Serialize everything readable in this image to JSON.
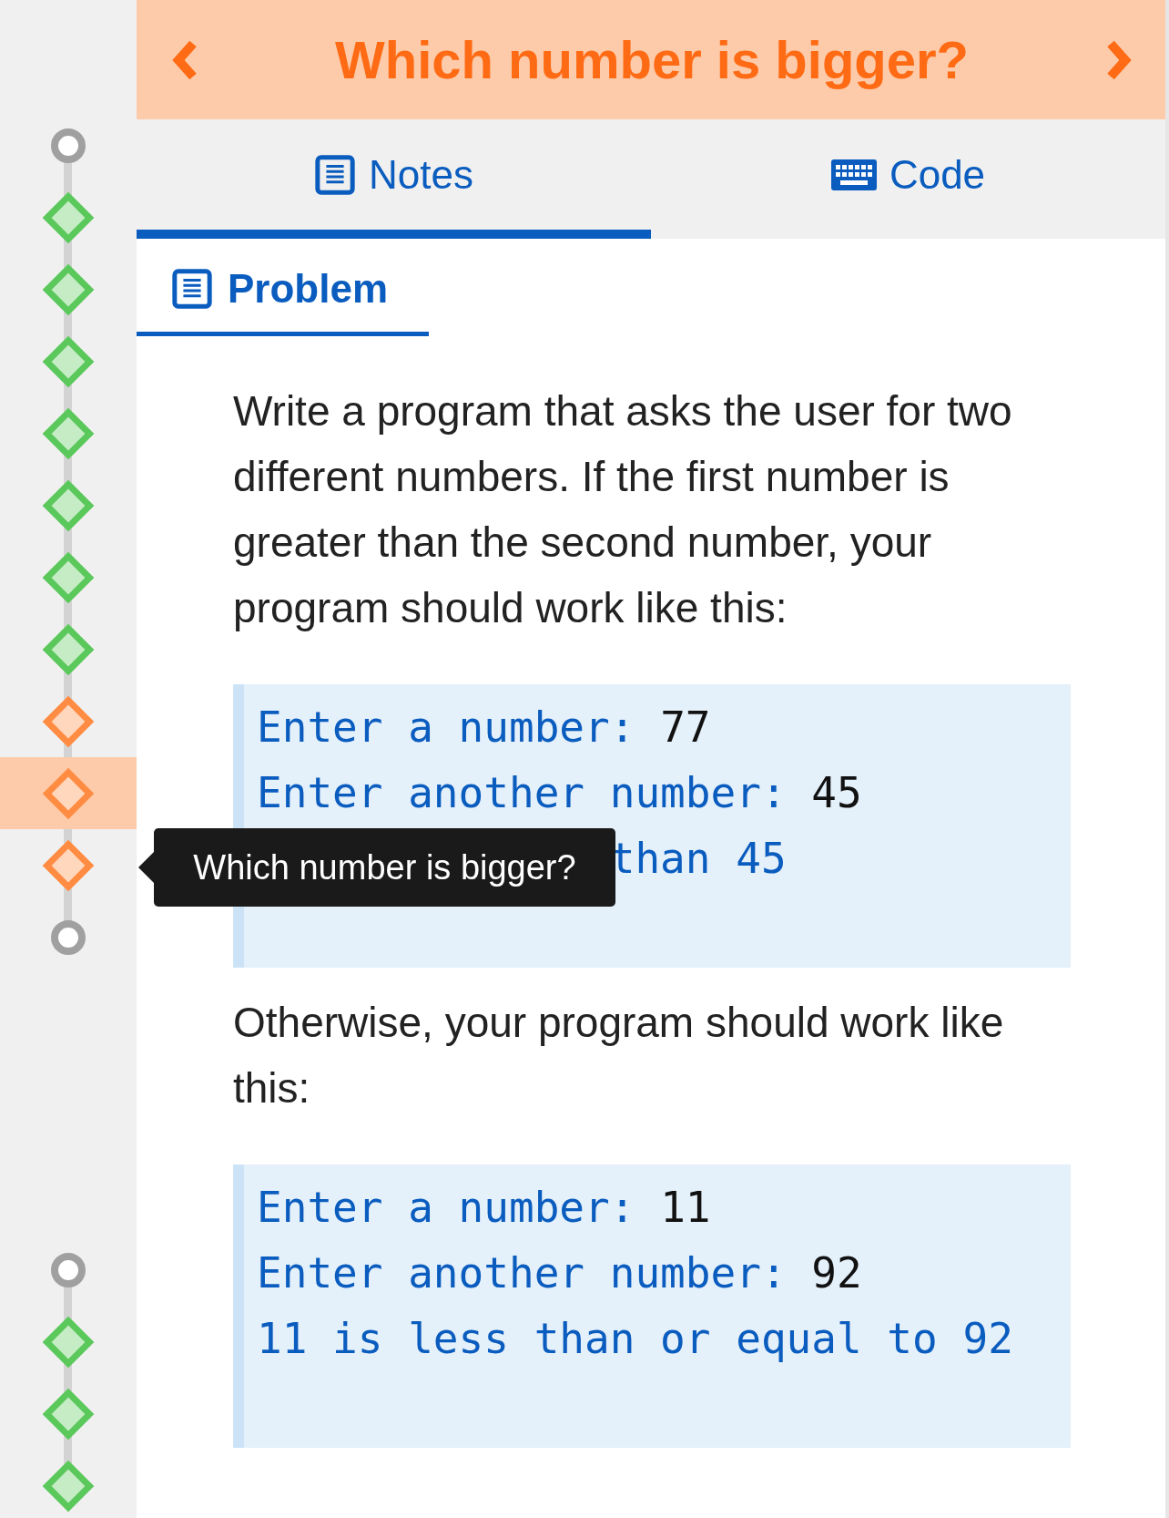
{
  "header": {
    "title": "Which number is bigger?"
  },
  "timeline": [
    {
      "items": [
        {
          "kind": "circle",
          "selected": false
        },
        {
          "kind": "diamond",
          "color": "#5ac85a",
          "selected": false
        },
        {
          "kind": "diamond",
          "color": "#5ac85a",
          "selected": false
        },
        {
          "kind": "diamond",
          "color": "#5ac85a",
          "selected": false
        },
        {
          "kind": "diamond",
          "color": "#5ac85a",
          "selected": false
        },
        {
          "kind": "diamond",
          "color": "#5ac85a",
          "selected": false
        },
        {
          "kind": "diamond",
          "color": "#5ac85a",
          "selected": false
        },
        {
          "kind": "diamond",
          "color": "#5ac85a",
          "selected": false
        },
        {
          "kind": "diamond",
          "color": "#ff8c42",
          "selected": false
        },
        {
          "kind": "diamond",
          "color": "#ff8c42",
          "selected": true
        },
        {
          "kind": "diamond",
          "color": "#ff8c42",
          "selected": false
        },
        {
          "kind": "circle",
          "selected": false
        }
      ]
    },
    {
      "items": [
        {
          "kind": "circle",
          "selected": false
        },
        {
          "kind": "diamond",
          "color": "#5ac85a",
          "selected": false
        },
        {
          "kind": "diamond",
          "color": "#5ac85a",
          "selected": false
        },
        {
          "kind": "diamond",
          "color": "#5ac85a",
          "selected": false
        }
      ]
    }
  ],
  "tooltip": {
    "text": "Which number is bigger?"
  },
  "tabs": [
    {
      "label": "Notes",
      "kind": "notes",
      "selected": true
    },
    {
      "label": "Code",
      "kind": "code",
      "selected": false
    }
  ],
  "section": {
    "title": "Problem"
  },
  "content": [
    {
      "kind": "paragraph",
      "text": "Write a program that asks the user for two different numbers. If the first number is greater than the second number, your program should work like this:"
    },
    {
      "kind": "code",
      "lines": [
        {
          "kind": "prompt",
          "prompt": "Enter a number:",
          "input": "77"
        },
        {
          "kind": "prompt",
          "prompt": "Enter another number:",
          "input": "45"
        },
        {
          "kind": "covered_output",
          "output": "than 45"
        }
      ]
    },
    {
      "kind": "paragraph",
      "text": "Otherwise, your program should work like this:"
    },
    {
      "kind": "code",
      "lines": [
        {
          "kind": "prompt",
          "prompt": "Enter a number:",
          "input": "11"
        },
        {
          "kind": "prompt",
          "prompt": "Enter another number:",
          "input": "92"
        },
        {
          "kind": "output",
          "output": "11 is less than or equal to 92"
        }
      ]
    }
  ]
}
